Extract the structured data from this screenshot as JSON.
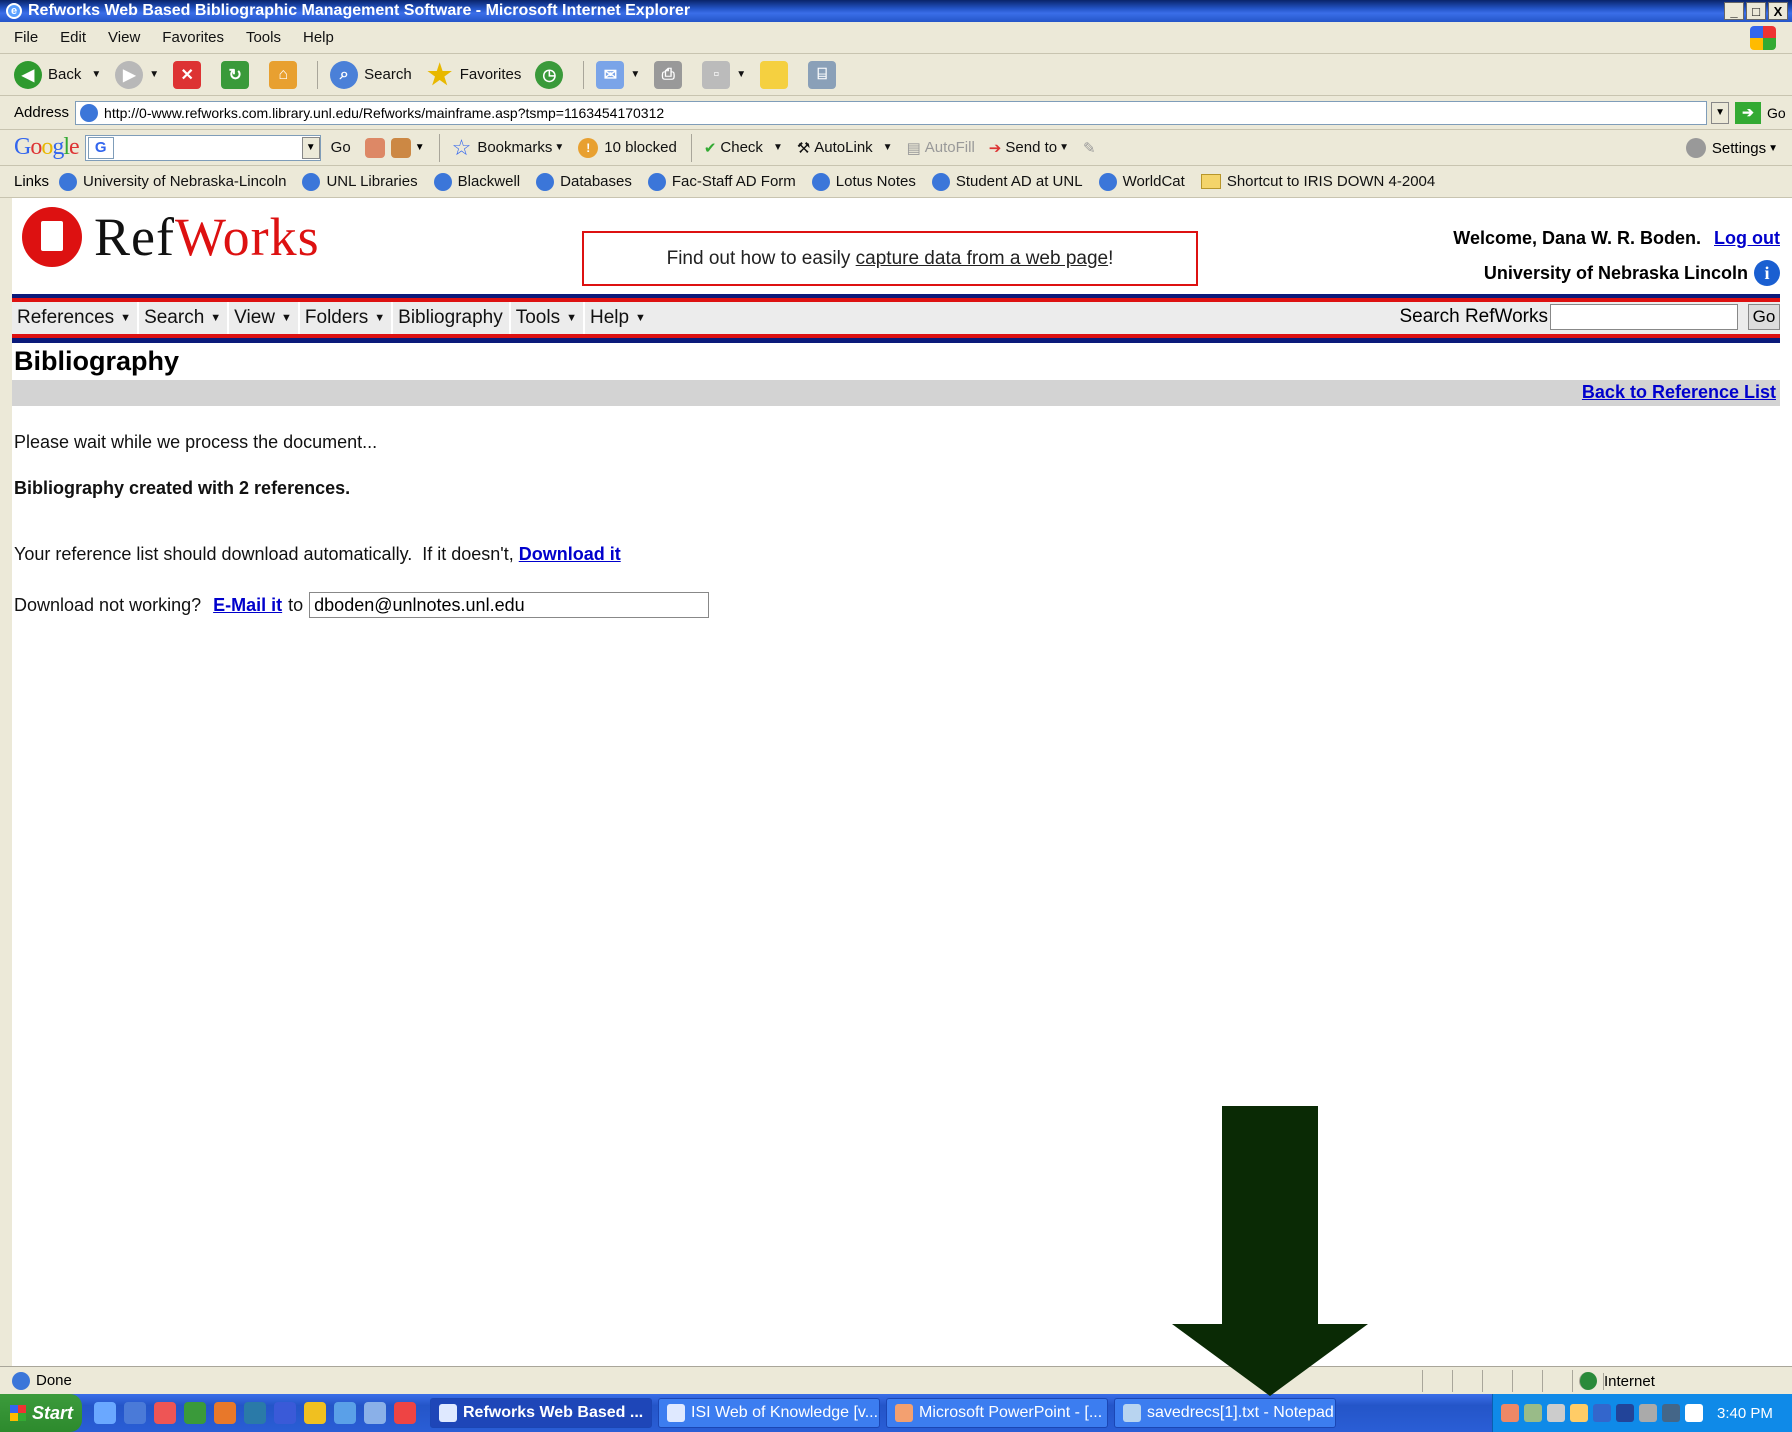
{
  "window": {
    "title": "Refworks Web Based Bibliographic Management Software - Microsoft Internet Explorer",
    "buttons": [
      "_",
      "□",
      "X"
    ]
  },
  "menu": [
    "File",
    "Edit",
    "View",
    "Favorites",
    "Tools",
    "Help"
  ],
  "toolbar": {
    "back": "Back",
    "search": "Search",
    "favorites": "Favorites"
  },
  "address": {
    "label": "Address",
    "url": "http://0-www.refworks.com.library.unl.edu/Refworks/mainframe.asp?tsmp=1163454170312",
    "go": "Go"
  },
  "google_toolbar": {
    "logo": "Google",
    "go": "Go",
    "bookmarks": "Bookmarks",
    "blocked": "10 blocked",
    "check": "Check",
    "autolink": "AutoLink",
    "autofill": "AutoFill",
    "send_to": "Send to",
    "settings": "Settings"
  },
  "links": {
    "label": "Links",
    "items": [
      "University of Nebraska-Lincoln",
      "UNL Libraries",
      "Blackwell",
      "Databases",
      "Fac-Staff AD Form",
      "Lotus Notes",
      "Student AD at UNL",
      "WorldCat",
      "Shortcut to IRIS DOWN 4-2004"
    ]
  },
  "refworks": {
    "logo_ref": "Ref",
    "logo_works": "Works",
    "promo_prefix": "Find out how to easily ",
    "promo_link": "capture data from a web page",
    "promo_suffix": "!",
    "welcome": "Welcome, Dana W. R. Boden.",
    "logout": "Log out",
    "institution": "University of Nebraska Lincoln",
    "info_icon_char": "i"
  },
  "nav": {
    "items": [
      "References",
      "Search",
      "View",
      "Folders",
      "Bibliography",
      "Tools",
      "Help"
    ],
    "search_label": "Search RefWorks",
    "search_go": "Go"
  },
  "page": {
    "title": "Bibliography",
    "back_link": "Back to Reference List",
    "wait_msg": "Please wait while we process the document...",
    "created_msg": "Bibliography created with 2 references.",
    "download_msg": "Your reference list should download automatically.  If it doesn't, ",
    "download_link": "Download it",
    "not_working": "Download not working?",
    "email_link": "E-Mail it",
    "to": "to",
    "email_value": "dboden@unlnotes.unl.edu"
  },
  "status": {
    "text": "Done",
    "zone": "Internet"
  },
  "taskbar": {
    "start": "Start",
    "tasks": [
      "Refworks Web Based ...",
      "ISI Web of Knowledge [v...",
      "Microsoft PowerPoint - [...",
      "savedrecs[1].txt - Notepad"
    ],
    "clock": "3:40 PM"
  },
  "colors": {
    "refworks_red": "#d11111",
    "nav_blue": "#0b1a7a",
    "link_blue": "#0000cc",
    "arrow_green": "#0a2a05"
  }
}
